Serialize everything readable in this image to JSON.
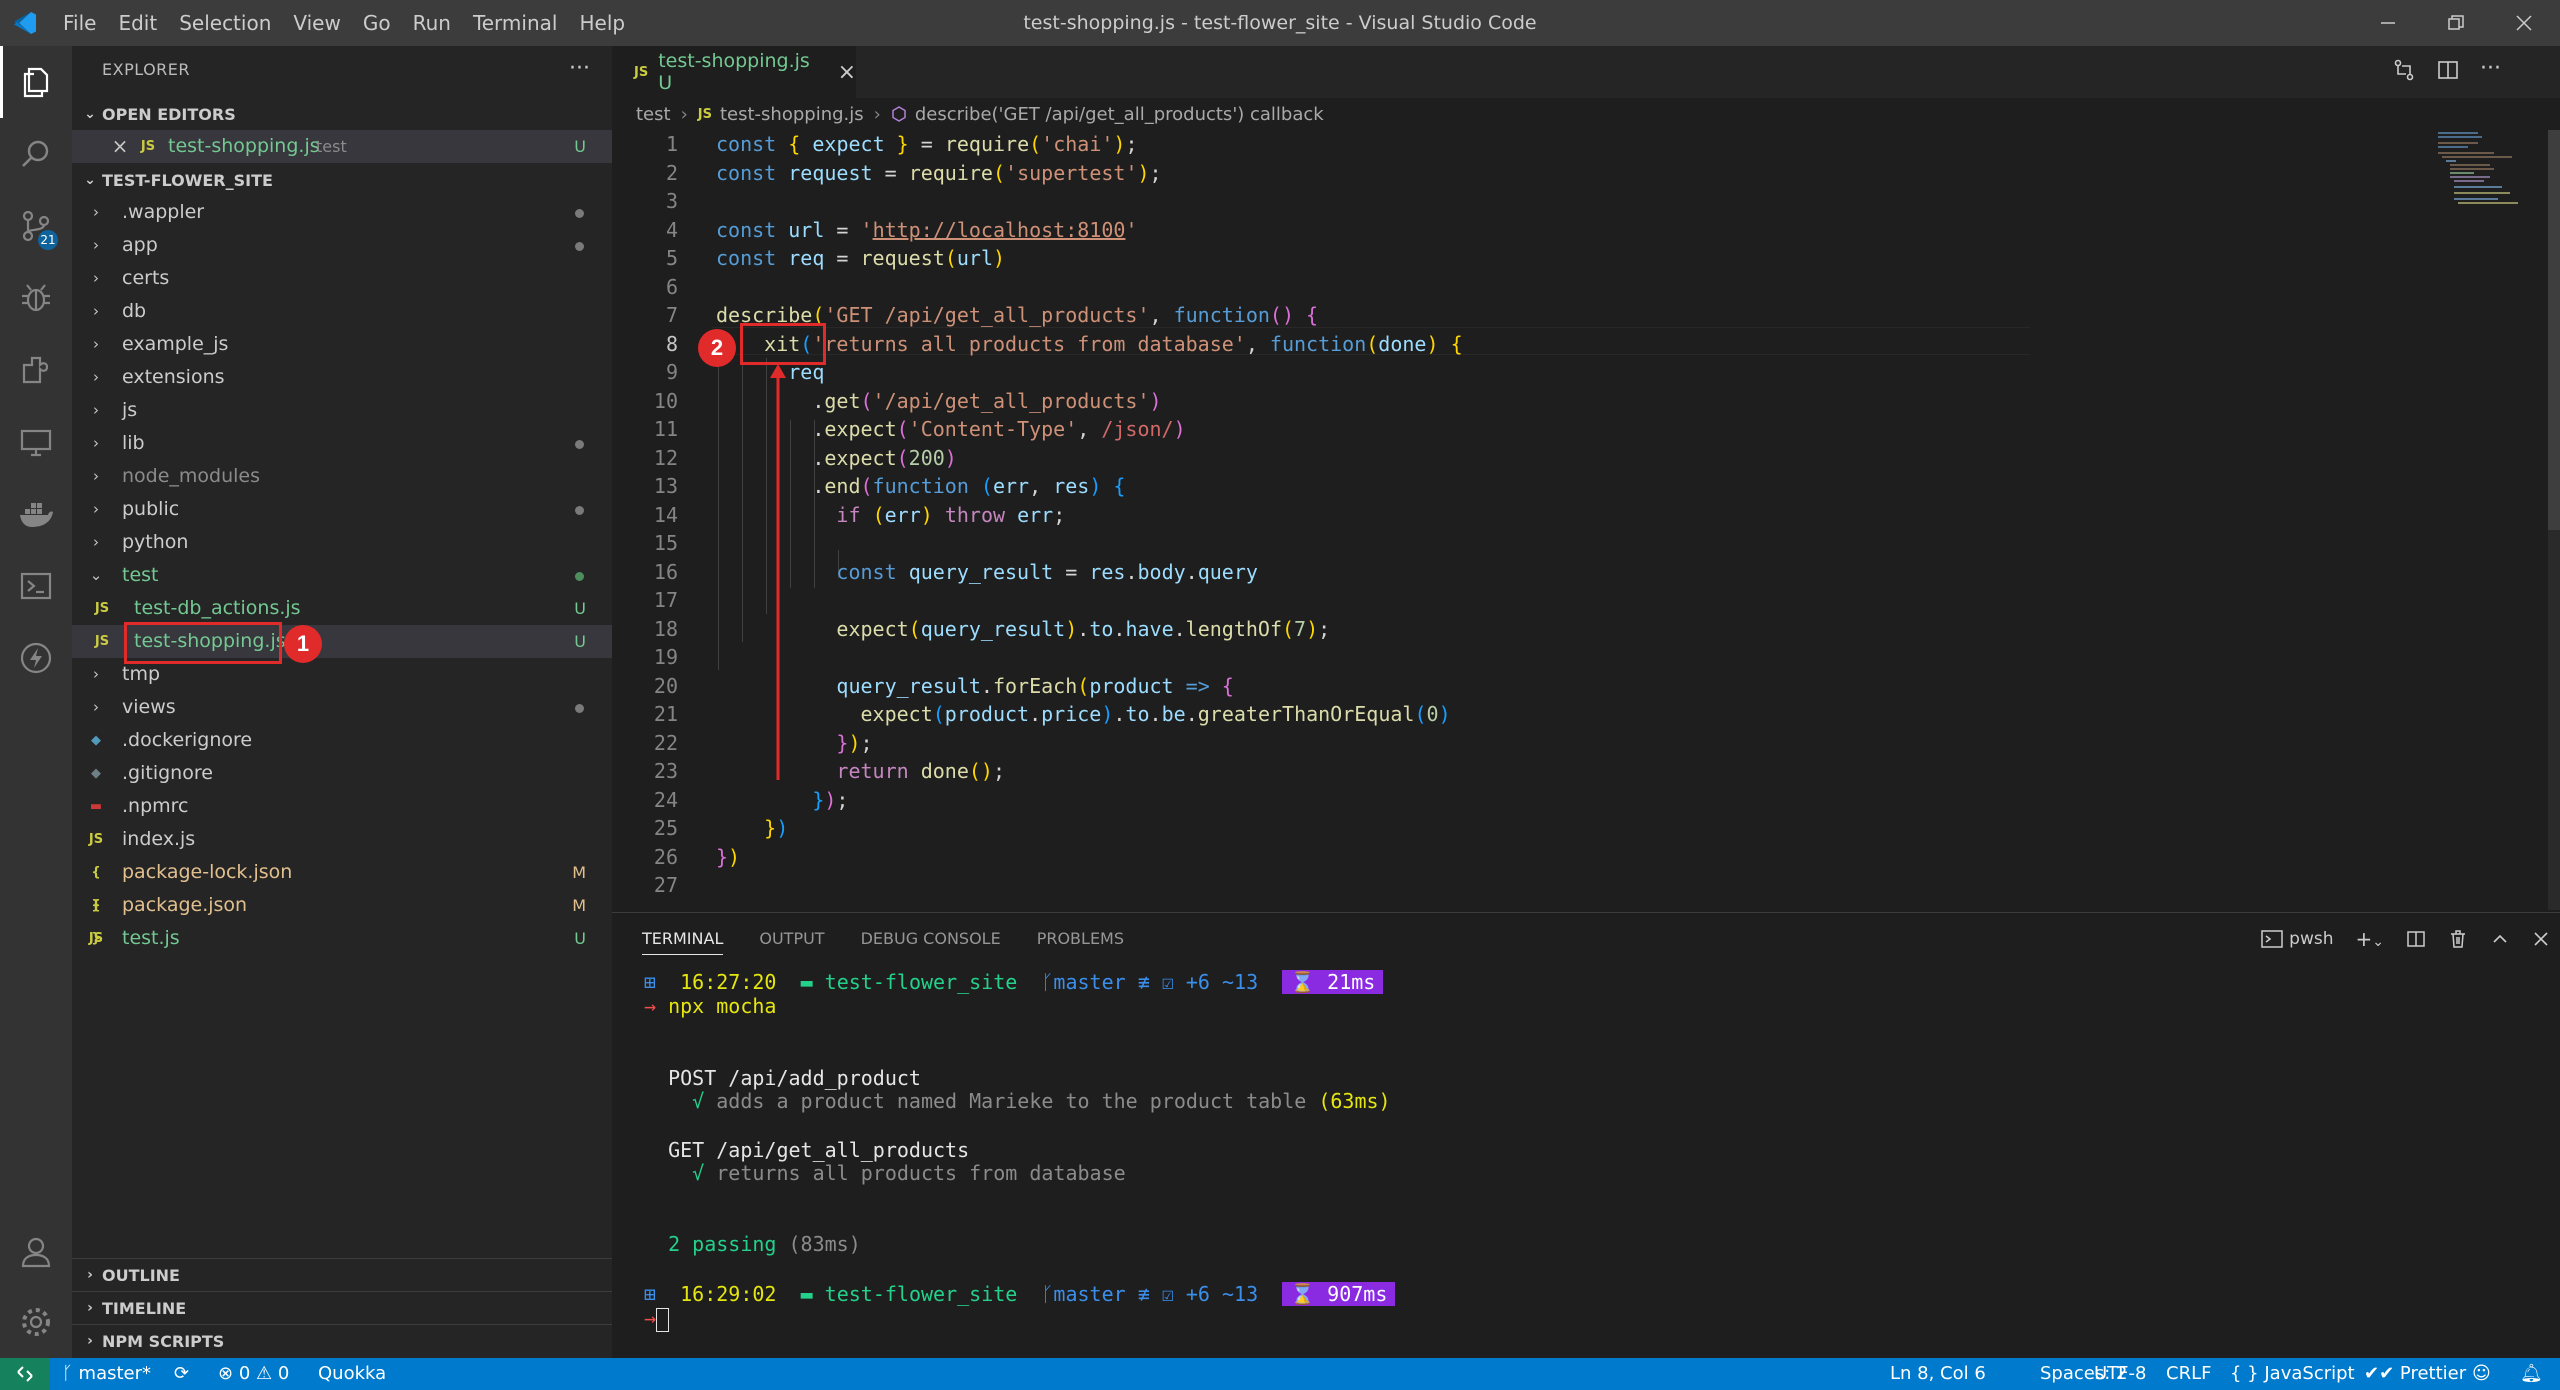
{
  "titlebar": {
    "menus": [
      "File",
      "Edit",
      "Selection",
      "View",
      "Go",
      "Run",
      "Terminal",
      "Help"
    ],
    "title": "test-shopping.js - test-flower_site - Visual Studio Code"
  },
  "activitybar": {
    "items": [
      "explorer-icon",
      "search-icon",
      "source-control-icon",
      "run-debug-icon",
      "extensions-icon",
      "remote-explorer-icon",
      "docker-icon",
      "terminal-icon",
      "lightning-icon"
    ],
    "scm_badge": "21",
    "bottom": [
      "account-icon",
      "manage-gear-icon"
    ]
  },
  "sidebar": {
    "header": "EXPLORER",
    "more": "···",
    "open_editors_title": "OPEN EDITORS",
    "open_editor": {
      "icon": "JS",
      "name": "test-shopping.js",
      "folder": "test",
      "status": "U"
    },
    "folder_title": "TEST-FLOWER_SITE",
    "tree": [
      {
        "type": "folder",
        "name": ".wappler",
        "status": "dot"
      },
      {
        "type": "folder",
        "name": "app",
        "status": "dot"
      },
      {
        "type": "folder",
        "name": "certs",
        "status": ""
      },
      {
        "type": "folder",
        "name": "db",
        "status": ""
      },
      {
        "type": "folder",
        "name": "example_js",
        "status": ""
      },
      {
        "type": "folder",
        "name": "extensions",
        "status": ""
      },
      {
        "type": "folder",
        "name": "js",
        "status": ""
      },
      {
        "type": "folder",
        "name": "lib",
        "status": "dot"
      },
      {
        "type": "folder",
        "name": "node_modules",
        "status": ""
      },
      {
        "type": "folder",
        "name": "public",
        "status": "dot"
      },
      {
        "type": "folder",
        "name": "python",
        "status": ""
      },
      {
        "type": "folder-open",
        "name": "test",
        "status": "dot-green"
      },
      {
        "type": "file",
        "icon": "JS",
        "name": "test-db_actions.js",
        "status": "U"
      },
      {
        "type": "file",
        "icon": "JS",
        "name": "test-shopping.js",
        "status": "U"
      },
      {
        "type": "folder",
        "name": "tmp",
        "status": ""
      },
      {
        "type": "folder",
        "name": "views",
        "status": "dot"
      },
      {
        "type": "file",
        "icon": "docker",
        "name": ".dockerignore",
        "status": ""
      },
      {
        "type": "file",
        "icon": "git",
        "name": ".gitignore",
        "status": ""
      },
      {
        "type": "file",
        "icon": "npm",
        "name": ".npmrc",
        "status": ""
      },
      {
        "type": "file",
        "icon": "JS",
        "name": "index.js",
        "status": ""
      },
      {
        "type": "file",
        "icon": "{}",
        "name": "package-lock.json",
        "status": "M"
      },
      {
        "type": "file",
        "icon": "{}",
        "name": "package.json",
        "status": "M"
      },
      {
        "type": "file",
        "icon": "JS",
        "name": "test.js",
        "status": "U"
      }
    ],
    "outline": "OUTLINE",
    "timeline": "TIMELINE",
    "npm_scripts": "NPM SCRIPTS"
  },
  "editor": {
    "tab": {
      "icon": "JS",
      "name": "test-shopping.js",
      "status": "U"
    },
    "breadcrumb": [
      "test",
      "test-shopping.js",
      "describe('GET /api/get_all_products') callback"
    ],
    "line_numbers": [
      "1",
      "2",
      "3",
      "4",
      "5",
      "6",
      "7",
      "8",
      "9",
      "10",
      "11",
      "12",
      "13",
      "14",
      "15",
      "16",
      "17",
      "18",
      "19",
      "20",
      "21",
      "22",
      "23",
      "24",
      "25",
      "26",
      "27"
    ],
    "current_line": 8
  },
  "panel": {
    "tabs": [
      "TERMINAL",
      "OUTPUT",
      "DEBUG CONSOLE",
      "PROBLEMS"
    ],
    "shell": "pwsh",
    "prompt1": {
      "time": "16:27:20",
      "dir": "test-flower_site",
      "git": "master ≢ ☑ +6 ~13",
      "duration": "21ms"
    },
    "command": "npx mocha",
    "suite1": "POST /api/add_product",
    "test1": "adds a product named Marieke to the product table",
    "test1_time": "(63ms)",
    "suite2": "GET /api/get_all_products",
    "test2": "returns all products from database",
    "passing": "2 passing",
    "passing_time": "(83ms)",
    "prompt2": {
      "time": "16:29:02",
      "dir": "test-flower_site",
      "git": "master ≢ ☑ +6 ~13",
      "duration": "907ms"
    }
  },
  "statusbar": {
    "branch": "master*",
    "errors": "0",
    "warnings": "0",
    "quokka": "Quokka",
    "position": "Ln 8, Col 6",
    "spaces": "Spaces: 2",
    "encoding": "UTF-8",
    "eol": "CRLF",
    "language": "JavaScript",
    "prettier": "Prettier"
  },
  "annotations": {
    "callout1": "1",
    "callout2": "2"
  }
}
